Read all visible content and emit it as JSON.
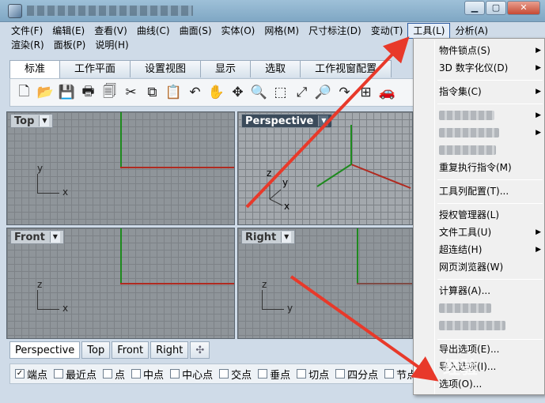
{
  "window": {
    "controls": {
      "minimize": "▁",
      "maximize": "▢",
      "close": "✕"
    }
  },
  "menubar": {
    "row1": [
      "文件(F)",
      "编辑(E)",
      "查看(V)",
      "曲线(C)",
      "曲面(S)",
      "实体(O)",
      "网格(M)",
      "尺寸标注(D)",
      "变动(T)",
      "工具(L)",
      "分析(A)"
    ],
    "row2": [
      "渲染(R)",
      "面板(P)",
      "说明(H)"
    ],
    "active": "工具(L)"
  },
  "tabs": [
    "标准",
    "工作平面",
    "设置视图",
    "显示",
    "选取",
    "工作视窗配置"
  ],
  "toolbar": {
    "icons": [
      "new-file-icon",
      "open-folder-icon",
      "save-icon",
      "print-icon",
      "import-icon",
      "cut-icon",
      "copy-icon",
      "paste-icon",
      "undo-icon",
      "pan-hand-icon",
      "rotate-view-icon",
      "zoom-icon",
      "zoom-window-icon",
      "zoom-extents-icon",
      "zoom-selected-icon",
      "redo-view-icon",
      "viewport-layout-icon",
      "car-render-icon"
    ],
    "glyphs": [
      "🗋",
      "📂",
      "💾",
      "🖶",
      "🗐",
      "✂",
      "⧉",
      "📋",
      "↶",
      "✋",
      "✥",
      "🔍",
      "⬚",
      "⤢",
      "🔎",
      "↷",
      "⊞",
      "🚗"
    ]
  },
  "viewports": {
    "top": "Top",
    "perspective": "Perspective",
    "front": "Front",
    "right": "Right",
    "axis_x": "x",
    "axis_y": "y",
    "axis_z": "z"
  },
  "viewport_tabs": [
    "Perspective",
    "Top",
    "Front",
    "Right"
  ],
  "viewport_tab_add": "✣",
  "osnaps": [
    {
      "label": "端点",
      "checked": true
    },
    {
      "label": "最近点",
      "checked": false
    },
    {
      "label": "点",
      "checked": false
    },
    {
      "label": "中点",
      "checked": false
    },
    {
      "label": "中心点",
      "checked": false
    },
    {
      "label": "交点",
      "checked": false
    },
    {
      "label": "垂点",
      "checked": false
    },
    {
      "label": "切点",
      "checked": false
    },
    {
      "label": "四分点",
      "checked": false
    },
    {
      "label": "节点",
      "checked": false
    }
  ],
  "tools_menu": {
    "items": {
      "object_snap": "物件锁点(S)",
      "digitizer": "3D 数字化仪(D)",
      "command_set": "指令集(C)",
      "repeat": "重复执行指令(M)",
      "toolbar_layout": "工具列配置(T)...",
      "license_manager": "授权管理器(L)",
      "file_tools": "文件工具(U)",
      "hyperlink": "超连结(H)",
      "web_browser": "网页浏览器(W)",
      "calculator": "计算器(A)...",
      "export_options": "导出选项(E)...",
      "import_options": "导入选项(I)...",
      "options": "选项(O)..."
    },
    "submenu_arrow": "▶"
  },
  "colors": {
    "annotation_red": "#e8392a",
    "axis_x": "#b02a20",
    "axis_y": "#1e8a1e"
  },
  "watermark": "经验"
}
